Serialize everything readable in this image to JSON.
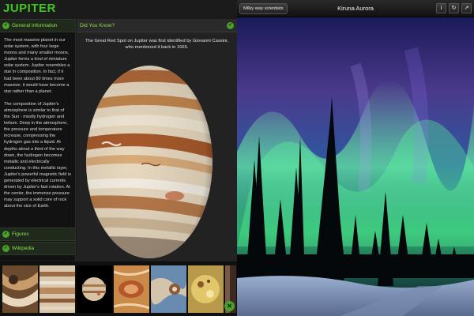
{
  "jupiter_app": {
    "title": "JUPITER",
    "title_color": "#3fc81b",
    "accent": "#8ee04a",
    "sections": {
      "general": "General Information",
      "figures": "Figures",
      "wikipedia": "Wikipedia"
    },
    "general_paragraphs": [
      "The most massive planet in our solar system, with four large moons and many smaller moons, Jupiter forms a kind of miniature solar system. Jupiter resembles a star in composition. In fact, if it had been about 80 times more massive, it would have become a star rather than a planet.",
      "The composition of Jupiter's atmosphere is similar to that of the Sun - mostly hydrogen and helium. Deep in the atmosphere, the pressure and temperature increase, compressing the hydrogen gas into a liquid. At depths about a third of the way down, the hydrogen becomes metallic and electrically conducting. In this metallic layer, Jupiter's powerful magnetic field is generated by electrical currents driven by Jupiter's fast rotation. At the center, the immense pressure may support a solid core of rock about the size of Earth."
    ],
    "did_you_know": {
      "heading": "Did You Know?",
      "text": "The Great Red Spot on Jupiter was first identified by Giovanni Cassini, who mentioned it back in 1665."
    },
    "thumbnails": [
      "swirl-detail",
      "banded-clouds",
      "jupiter-full",
      "red-spot",
      "storm-turbulence",
      "io-moon",
      "partial-edge"
    ],
    "close_icon": "x-close-icon"
  },
  "photo_viewer": {
    "back_label": "Milky way scientists",
    "title": "Kiruna Aurora",
    "icons": [
      "info-icon",
      "refresh-icon",
      "share-icon"
    ]
  }
}
